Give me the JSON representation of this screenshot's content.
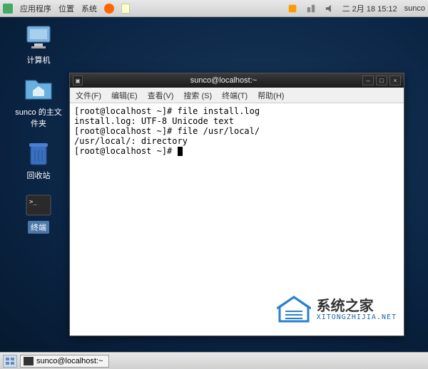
{
  "topbar": {
    "apps_label": "应用程序",
    "places_label": "位置",
    "system_label": "系统",
    "datetime": "二 2月 18 15:12",
    "user": "sunco"
  },
  "desktop": {
    "icons": [
      {
        "name": "computer",
        "label": "计算机"
      },
      {
        "name": "home-folder",
        "label": "sunco 的主文件夹"
      },
      {
        "name": "trash",
        "label": "回收站"
      },
      {
        "name": "terminal-shortcut",
        "label": "终端"
      }
    ]
  },
  "terminal": {
    "title": "sunco@localhost:~",
    "menu": {
      "file": "文件(F)",
      "edit": "编辑(E)",
      "view": "查看(V)",
      "search": "搜索 (S)",
      "terminal": "终端(T)",
      "help": "帮助(H)"
    },
    "lines": [
      "[root@localhost ~]# file install.log",
      "install.log: UTF-8 Unicode text",
      "[root@localhost ~]# file /usr/local/",
      "/usr/local/: directory",
      "[root@localhost ~]# "
    ]
  },
  "watermark": {
    "title": "系统之家",
    "subtitle": "XITONGZHIJIA.NET"
  },
  "taskbar": {
    "task_label": "sunco@localhost:~"
  }
}
